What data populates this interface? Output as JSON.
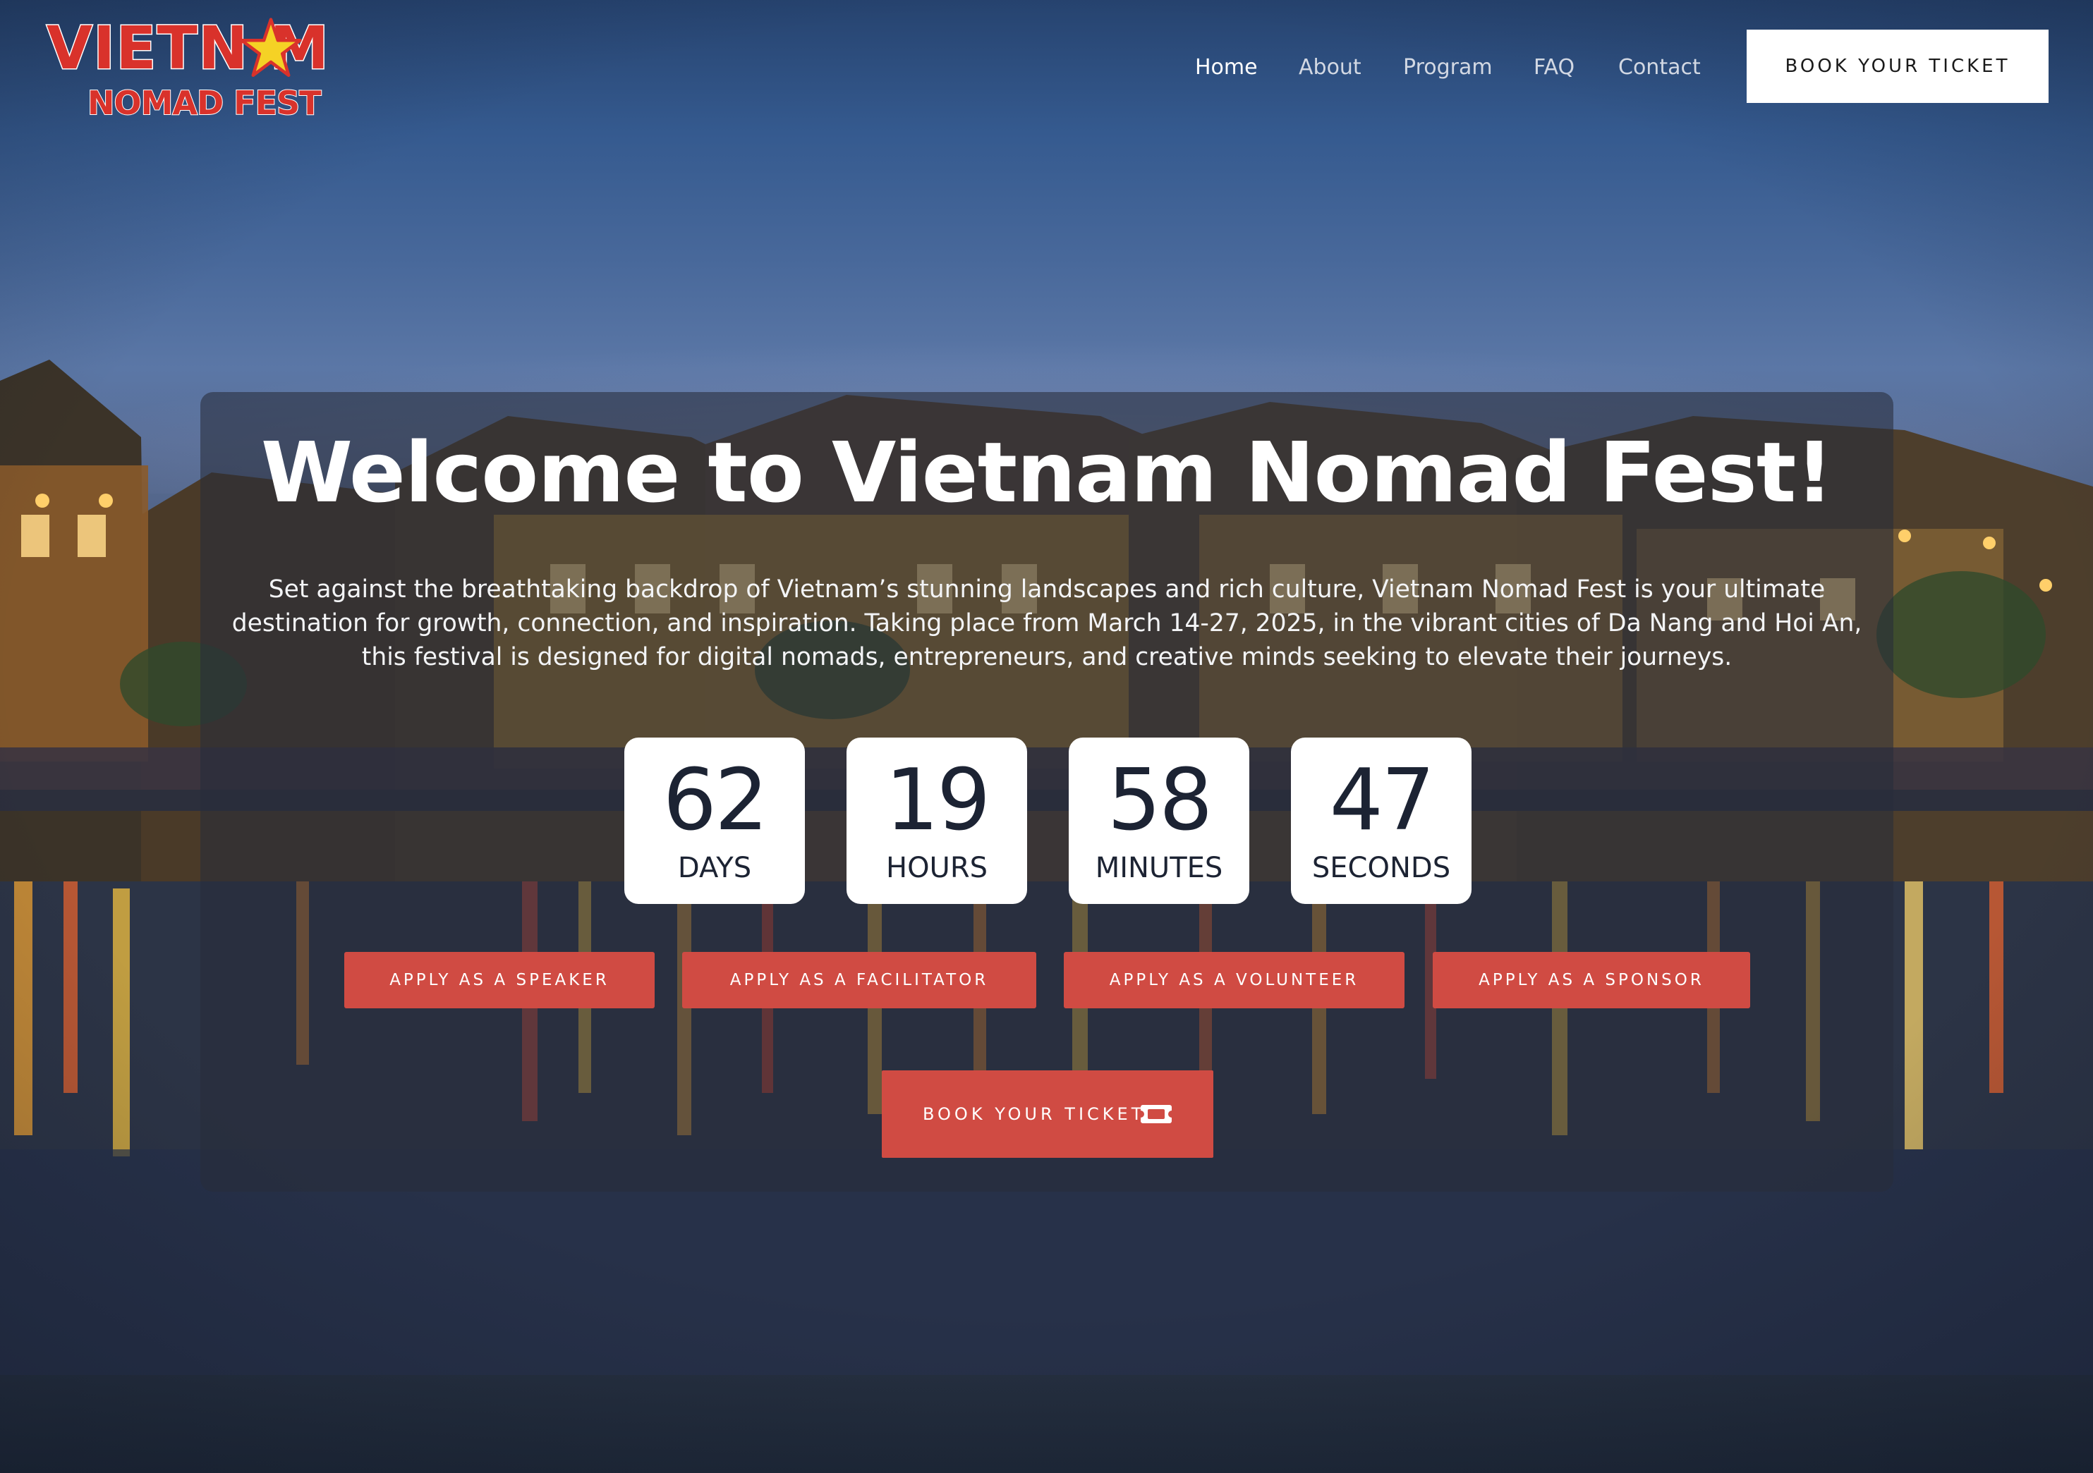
{
  "logo": {
    "line1": "VIETN   M",
    "line2": "NOMAD FEST",
    "star_color": "#f5d225",
    "brand_red": "#d9322b"
  },
  "nav": {
    "items": [
      {
        "label": "Home",
        "active": true
      },
      {
        "label": "About",
        "active": false
      },
      {
        "label": "Program",
        "active": false
      },
      {
        "label": "FAQ",
        "active": false
      },
      {
        "label": "Contact",
        "active": false
      }
    ],
    "cta_label": "BOOK YOUR TICKET"
  },
  "hero": {
    "title": "Welcome to Vietnam Nomad Fest!",
    "description": "Set against the breathtaking backdrop of Vietnam’s stunning landscapes and rich culture, Vietnam Nomad Fest is your ultimate destination for growth, connection, and inspiration. Taking place from March 14-27, 2025, in the vibrant cities of Da Nang and Hoi An, this festival is designed for digital nomads, entrepreneurs, and creative minds seeking to elevate their journeys."
  },
  "countdown": [
    {
      "value": "62",
      "label": "DAYS"
    },
    {
      "value": "19",
      "label": "HOURS"
    },
    {
      "value": "58",
      "label": "MINUTES"
    },
    {
      "value": "47",
      "label": "SECONDS"
    }
  ],
  "apply_buttons": [
    {
      "label": "APPLY AS A SPEAKER"
    },
    {
      "label": "APPLY AS A FACILITATOR"
    },
    {
      "label": "APPLY AS A VOLUNTEER"
    },
    {
      "label": "APPLY AS A SPONSOR"
    }
  ],
  "book_button": {
    "label": "BOOK YOUR TICKET",
    "icon": "ticket-icon"
  },
  "colors": {
    "accent": "#d04b43",
    "panel": "rgba(40,45,58,0.58)",
    "countdown_text": "#1c2333"
  }
}
